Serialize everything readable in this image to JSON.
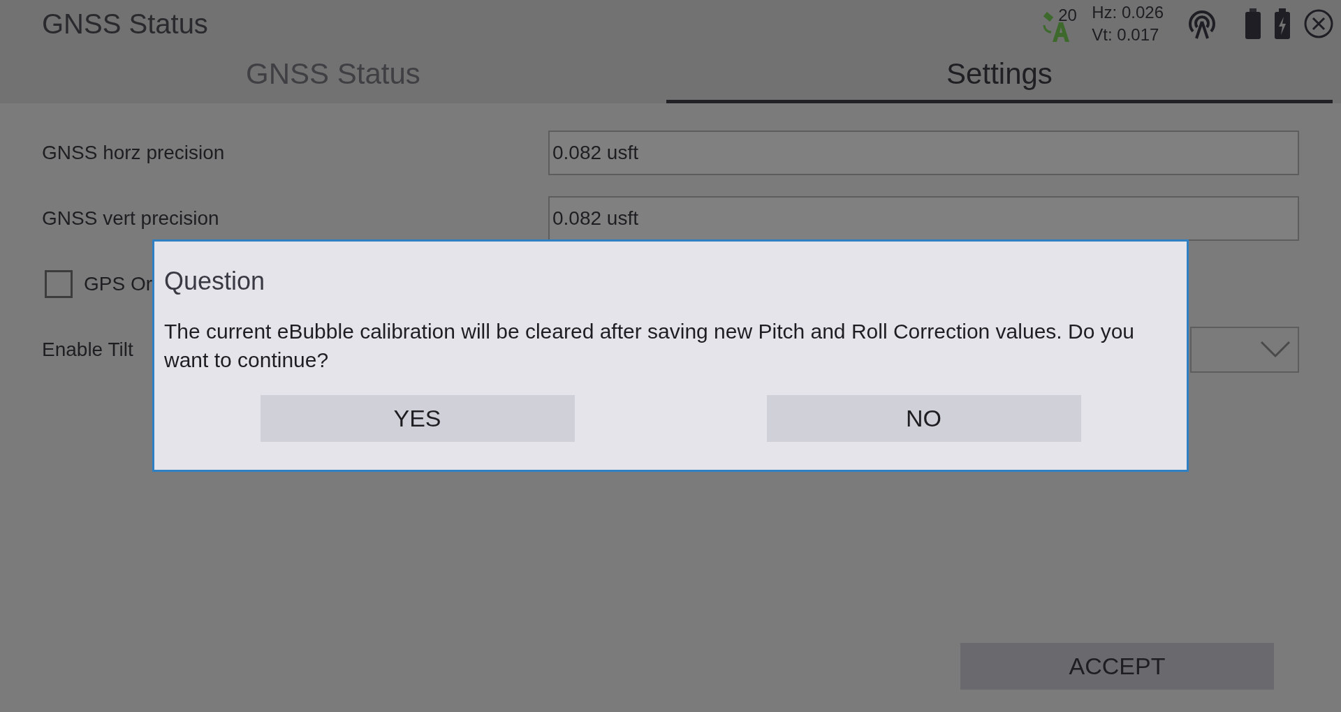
{
  "window": {
    "title": "GNSS Status"
  },
  "status": {
    "satellites": "20",
    "hz": "Hz: 0.026",
    "vt": "Vt: 0.017"
  },
  "tabs": [
    {
      "label": "GNSS Status",
      "selected": false
    },
    {
      "label": "Settings",
      "selected": true
    }
  ],
  "settings": [
    {
      "kind": "field",
      "label": "GNSS horz precision",
      "value": "0.082 usft"
    },
    {
      "kind": "field",
      "label": "GNSS vert precision",
      "value": "0.082 usft"
    },
    {
      "kind": "checkbox",
      "label": "GPS Or",
      "checked": false
    },
    {
      "kind": "dropdown",
      "label": "Enable Tilt"
    }
  ],
  "accept_button": "ACCEPT",
  "dialog": {
    "title": "Question",
    "message": "The current eBubble calibration will be cleared after saving new Pitch and Roll Correction values. Do you want to continue?",
    "buttons": [
      "YES",
      "NO"
    ]
  }
}
